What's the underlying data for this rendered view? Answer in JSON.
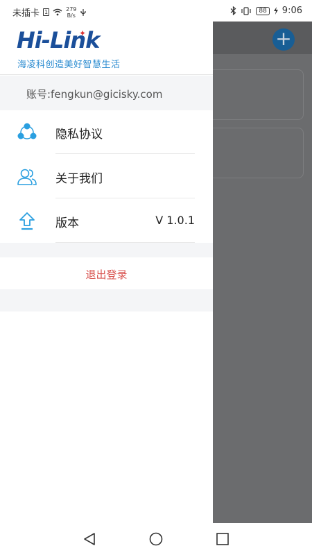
{
  "status_bar": {
    "carrier": "未插卡",
    "sim_badge": "1",
    "net_speed_value": "279",
    "net_speed_unit": "B/s",
    "battery": "88",
    "time": "9:06"
  },
  "drawer": {
    "logo": {
      "text": "Hi-Link",
      "slogan": "海凌科创造美好智慧生活"
    },
    "account": "账号:fengkun@gicisky.com",
    "menu": [
      {
        "label": "隐私协议",
        "icon": "privacy-icon"
      },
      {
        "label": "关于我们",
        "icon": "users-icon"
      },
      {
        "label": "版本",
        "icon": "upload-icon",
        "value": "V 1.0.1"
      }
    ],
    "logout": "退出登录"
  },
  "colors": {
    "accent": "#2a9fe0",
    "logout": "#d9534f",
    "overlay": "#6b6c6e",
    "add_button": "#185e95"
  }
}
